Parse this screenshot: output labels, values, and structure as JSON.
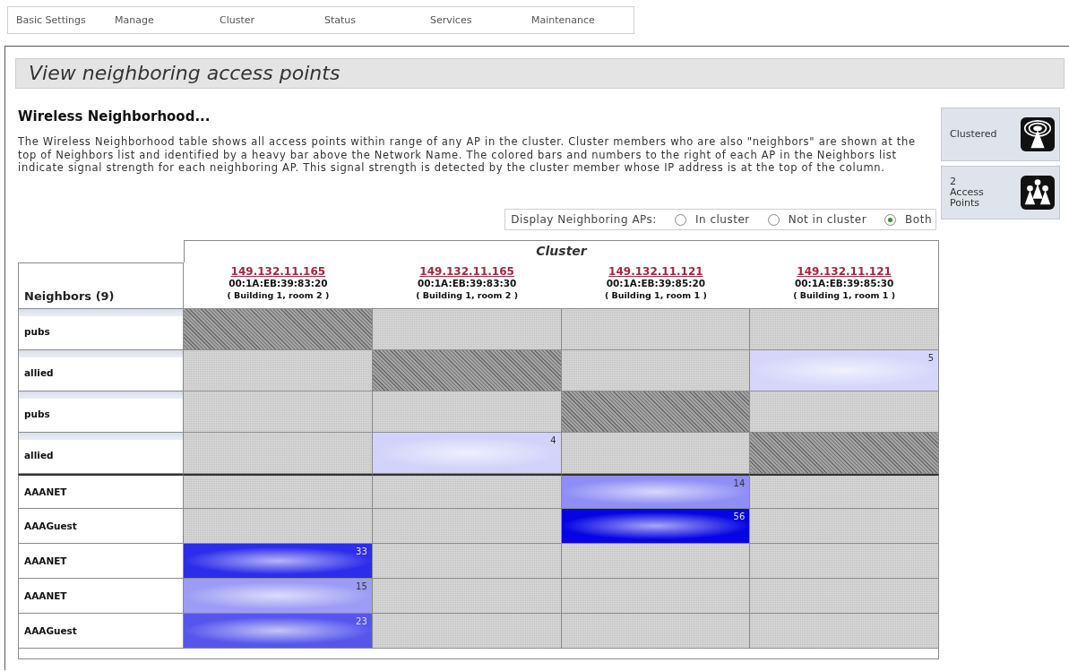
{
  "nav": [
    "Basic Settings",
    "Manage",
    "Cluster",
    "Status",
    "Services",
    "Maintenance"
  ],
  "page_title": "View neighboring access points",
  "section": {
    "heading": "Wireless Neighborhood...",
    "description": "The Wireless Neighborhood table shows all access points within range of any AP in the cluster. Cluster members who are also \"neighbors\" are shown at the top of Neighbors list and identified by a heavy bar above the Network Name. The colored bars and numbers to the right of each AP in the Neighbors list indicate signal strength for each neighboring AP. This signal strength is detected by the cluster member whose IP address is at the top of the column."
  },
  "display_filter": {
    "label": "Display Neighboring APs:",
    "options": [
      {
        "label": "In cluster",
        "selected": false
      },
      {
        "label": "Not in cluster",
        "selected": false
      },
      {
        "label": "Both",
        "selected": true
      }
    ]
  },
  "status_panel": [
    {
      "kind": "clustered",
      "label": "Clustered"
    },
    {
      "kind": "access-points",
      "count": "2",
      "label": "Access Points"
    }
  ],
  "table": {
    "group_header": "Cluster",
    "row_header": "Neighbors (9)",
    "columns": [
      {
        "ip": "149.132.11.165",
        "mac": "00:1A:EB:39:83:20",
        "location": "( Building 1, room 2 )"
      },
      {
        "ip": "149.132.11.165",
        "mac": "00:1A:EB:39:83:30",
        "location": "( Building 1, room 2 )"
      },
      {
        "ip": "149.132.11.121",
        "mac": "00:1A:EB:39:85:20",
        "location": "( Building 1, room 1 )"
      },
      {
        "ip": "149.132.11.121",
        "mac": "00:1A:EB:39:85:30",
        "location": "( Building 1, room 1 )"
      }
    ],
    "rows": [
      {
        "network": "pubs",
        "cluster_member": true,
        "cells": [
          {
            "kind": "self"
          },
          {
            "kind": "none"
          },
          {
            "kind": "none"
          },
          {
            "kind": "none"
          }
        ]
      },
      {
        "network": "allied",
        "cluster_member": true,
        "cells": [
          {
            "kind": "none"
          },
          {
            "kind": "self"
          },
          {
            "kind": "none"
          },
          {
            "kind": "signal",
            "reading": "5",
            "color": "#d6d6fb"
          }
        ]
      },
      {
        "network": "pubs",
        "cluster_member": true,
        "cells": [
          {
            "kind": "none"
          },
          {
            "kind": "none"
          },
          {
            "kind": "self"
          },
          {
            "kind": "none"
          }
        ]
      },
      {
        "network": "allied",
        "cluster_member": true,
        "cells": [
          {
            "kind": "none"
          },
          {
            "kind": "signal",
            "reading": "4",
            "color": "#d2d2fa"
          },
          {
            "kind": "none"
          },
          {
            "kind": "self"
          }
        ]
      },
      {
        "network": "AAANET",
        "cluster_member": false,
        "cells": [
          {
            "kind": "none"
          },
          {
            "kind": "none"
          },
          {
            "kind": "signal",
            "reading": "14",
            "color": "#8e8ef6"
          },
          {
            "kind": "none"
          }
        ]
      },
      {
        "network": "AAAGuest",
        "cluster_member": false,
        "cells": [
          {
            "kind": "none"
          },
          {
            "kind": "none"
          },
          {
            "kind": "signal",
            "reading": "56",
            "color": "#0505e4"
          },
          {
            "kind": "none"
          }
        ]
      },
      {
        "network": "AAANET",
        "cluster_member": false,
        "cells": [
          {
            "kind": "signal",
            "reading": "33",
            "color": "#2c2ceb"
          },
          {
            "kind": "none"
          },
          {
            "kind": "none"
          },
          {
            "kind": "none"
          }
        ]
      },
      {
        "network": "AAANET",
        "cluster_member": false,
        "cells": [
          {
            "kind": "signal",
            "reading": "15",
            "color": "#9c9cf6"
          },
          {
            "kind": "none"
          },
          {
            "kind": "none"
          },
          {
            "kind": "none"
          }
        ]
      },
      {
        "network": "AAAGuest",
        "cluster_member": false,
        "cells": [
          {
            "kind": "signal",
            "reading": "23",
            "color": "#5656ee"
          },
          {
            "kind": "none"
          },
          {
            "kind": "none"
          },
          {
            "kind": "none"
          }
        ]
      }
    ]
  }
}
